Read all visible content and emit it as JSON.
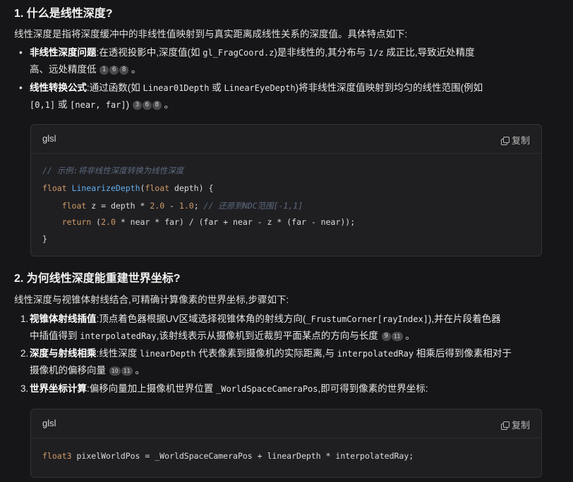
{
  "section1": {
    "heading": "1. 什么是线性深度?",
    "intro": "线性深度是指将深度缓冲中的非线性值映射到与真实距离成线性关系的深度值。具体特点如下:",
    "bullets": [
      {
        "title": "非线性深度问题",
        "line1_a": ":在透视投影中,深度值(如 ",
        "line1_code1": "gl_FragCoord.z",
        "line1_b": ")是非线性的,其分布与 ",
        "line1_code2": "1/z",
        "line1_c": " 成正比,导致近处精度",
        "line2": "高、远处精度低",
        "cites": [
          "1",
          "6",
          "8"
        ]
      },
      {
        "title": "线性转换公式",
        "line1_a": ":通过函数(如 ",
        "line1_code1": "Linear01Depth",
        "line1_b": " 或 ",
        "line1_code2": "LinearEyeDepth",
        "line1_c": ")将非线性深度值映射到均匀的线性范围(例如",
        "line2_code1": "[0,1]",
        "line2_b": " 或 ",
        "line2_code2": "[near, far]",
        "line2_c": ")",
        "cites": [
          "3",
          "6",
          "8"
        ]
      }
    ],
    "code": {
      "lang": "glsl",
      "copy_label": "复制",
      "comment1": "// 示例:将非线性深度转换为线性深度",
      "l2_kw": "float",
      "l2_fn": "LinearizeDepth",
      "l2_p1": "(",
      "l2_kw2": "float",
      "l2_p2": " depth) {",
      "l3_kw": "float",
      "l3_a": " z = depth * ",
      "l3_n1": "2.0",
      "l3_b": " - ",
      "l3_n2": "1.0",
      "l3_c": "; ",
      "l3_cm": "// 还原到NDC范围[-1,1]",
      "l4_kw": "return",
      "l4_a": " (",
      "l4_n1": "2.0",
      "l4_b": " * near * far) / (far + near - z * (far - near));",
      "l5": "}"
    }
  },
  "section2": {
    "heading": "2. 为何线性深度能重建世界坐标?",
    "intro": "线性深度与视锥体射线结合,可精确计算像素的世界坐标,步骤如下:",
    "items": [
      {
        "num": "1.",
        "title": "视锥体射线插值",
        "line1_a": ":顶点着色器根据UV区域选择视锥体角的射线方向(",
        "line1_code": "_FrustumCorner[rayIndex]",
        "line1_b": "),并在片段着色器",
        "line2_a": "中插值得到 ",
        "line2_code": "interpolatedRay",
        "line2_b": ",该射线表示从摄像机到近裁剪平面某点的方向与长度",
        "cites": [
          "9",
          "11"
        ]
      },
      {
        "num": "2.",
        "title": "深度与射线相乘",
        "line1_a": ":线性深度 ",
        "line1_code": "linearDepth",
        "line1_b": " 代表像素到摄像机的实际距离,与 ",
        "line1_code2": "interpolatedRay",
        "line1_c": " 相乘后得到像素相对于",
        "line2_a": "摄像机的偏移向量",
        "cites": [
          "10",
          "11"
        ]
      },
      {
        "num": "3.",
        "title": "世界坐标计算",
        "line1_a": ":偏移向量加上摄像机世界位置 ",
        "line1_code": "_WorldSpaceCameraPos",
        "line1_b": ",即可得到像素的世界坐标:"
      }
    ],
    "code": {
      "lang": "glsl",
      "copy_label": "复制",
      "l1_ty": "float3",
      "l1_rest": " pixelWorldPos = _WorldSpaceCameraPos + linearDepth * interpolatedRay;"
    }
  }
}
